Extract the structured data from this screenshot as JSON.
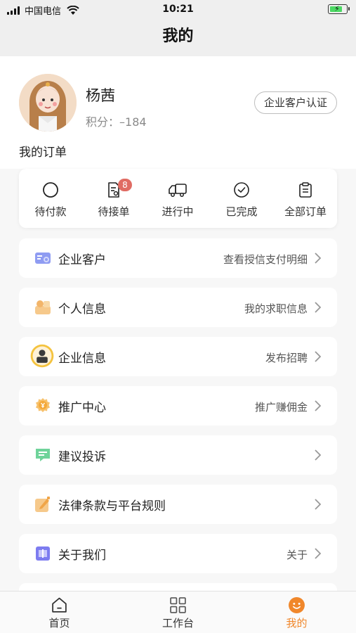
{
  "status_bar": {
    "carrier": "中国电信",
    "time": "10:21"
  },
  "nav": {
    "title": "我的"
  },
  "profile": {
    "name": "杨茜",
    "points_label": "积分：",
    "points_value": "–184",
    "cert_button": "企业客户认证"
  },
  "orders": {
    "title": "我的订单",
    "items": [
      {
        "label": "待付款",
        "icon": "circle-icon"
      },
      {
        "label": "待接单",
        "icon": "document-icon",
        "badge": "8"
      },
      {
        "label": "进行中",
        "icon": "truck-icon"
      },
      {
        "label": "已完成",
        "icon": "check-circle-icon"
      },
      {
        "label": "全部订单",
        "icon": "clipboard-icon"
      }
    ]
  },
  "menu": [
    {
      "label": "企业客户",
      "sub": "查看授信支付明细",
      "icon": "enterprise-card-icon"
    },
    {
      "label": "个人信息",
      "sub": "我的求职信息",
      "icon": "personal-info-icon"
    },
    {
      "label": "企业信息",
      "sub": "发布招聘",
      "icon": "company-info-icon"
    },
    {
      "label": "推广中心",
      "sub": "推广赚佣金",
      "icon": "promotion-coin-icon"
    },
    {
      "label": "建议投诉",
      "sub": "",
      "icon": "feedback-icon"
    },
    {
      "label": "法律条款与平台规则",
      "sub": "",
      "icon": "terms-edit-icon"
    },
    {
      "label": "关于我们",
      "sub": "关于",
      "icon": "about-book-icon"
    }
  ],
  "tabs": [
    {
      "label": "首页",
      "icon": "home-icon"
    },
    {
      "label": "工作台",
      "icon": "grid-icon"
    },
    {
      "label": "我的",
      "icon": "smile-icon",
      "active": true
    }
  ],
  "colors": {
    "accent": "#f0872b",
    "badge": "#e06b63",
    "background": "#f7f7f7"
  }
}
